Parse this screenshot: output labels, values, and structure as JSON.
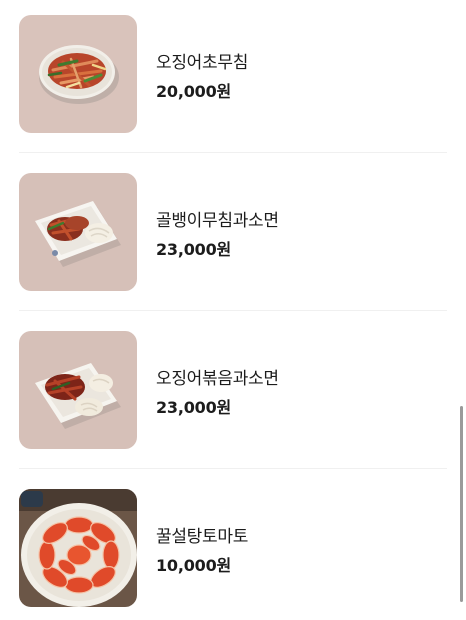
{
  "menu": {
    "items": [
      {
        "name": "오징어초무침",
        "price": "20,000원",
        "image_icon": "squid-salad-photo"
      },
      {
        "name": "골뱅이무침과소면",
        "price": "23,000원",
        "image_icon": "whelk-salad-noodles-photo"
      },
      {
        "name": "오징어볶음과소면",
        "price": "23,000원",
        "image_icon": "stir-fried-squid-noodles-photo"
      },
      {
        "name": "꿀설탕토마토",
        "price": "10,000원",
        "image_icon": "honey-sugar-tomato-photo"
      }
    ]
  },
  "colors": {
    "text": "#1c1c1c",
    "photo_background": "#d8c2ba",
    "divider": "#f0f0f0"
  }
}
